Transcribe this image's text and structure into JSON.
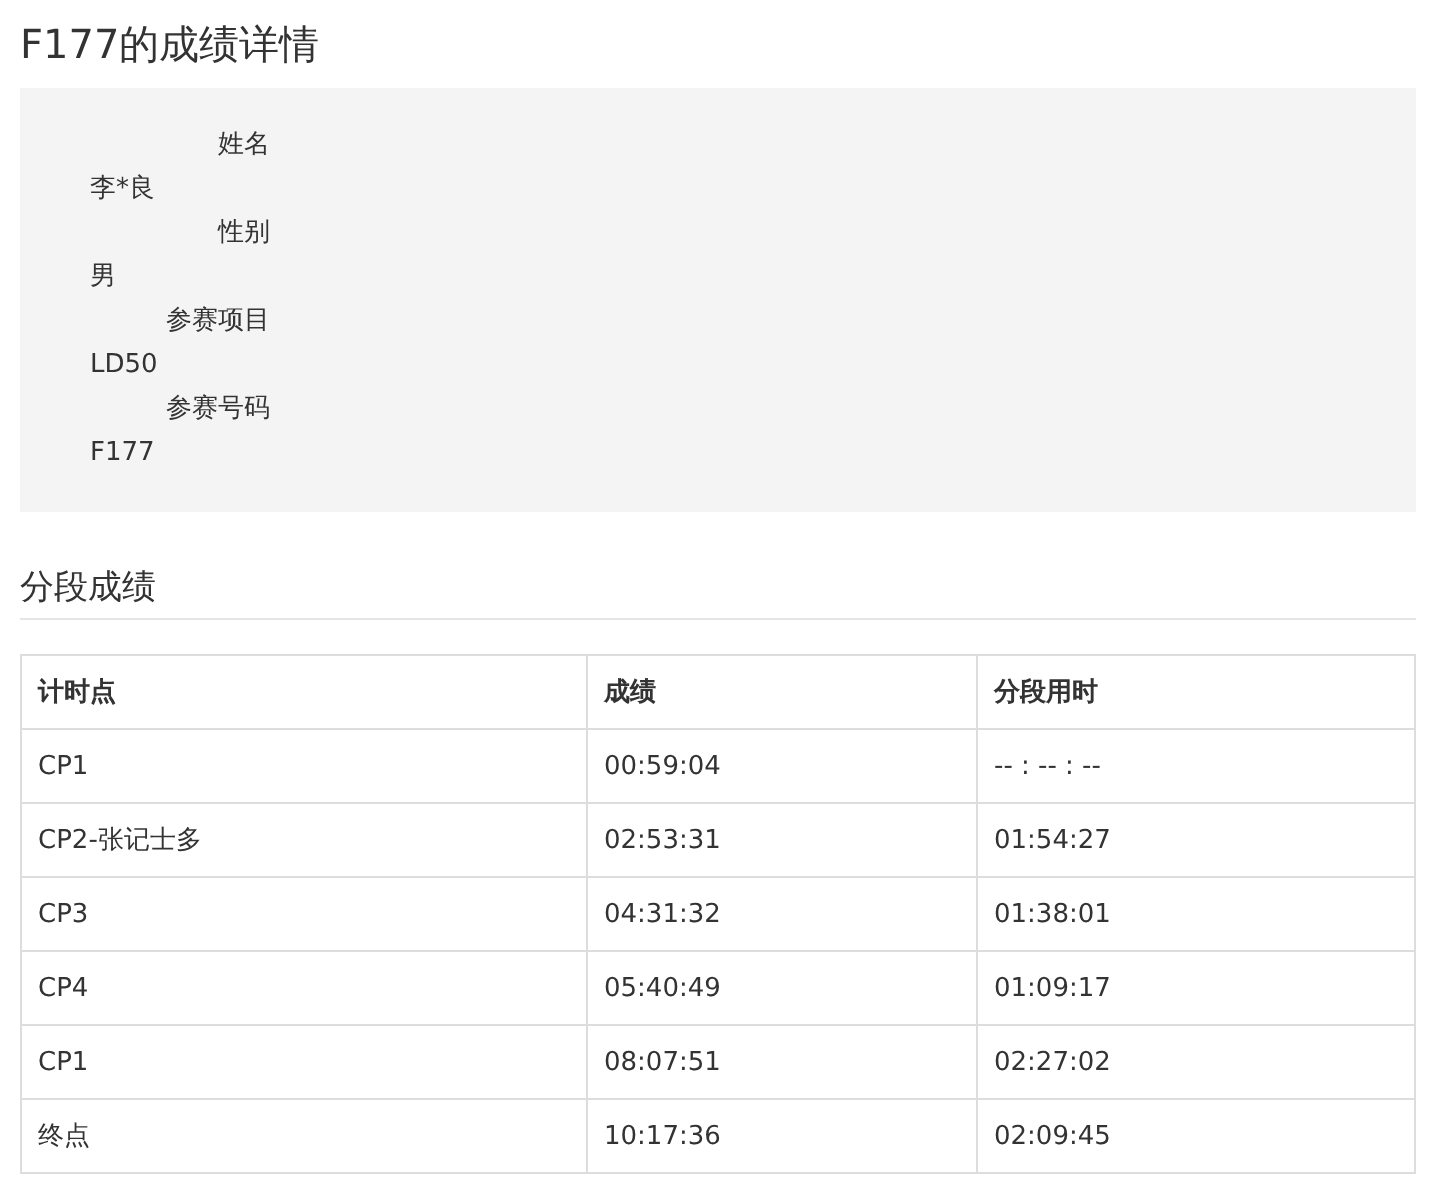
{
  "title": "F177的成绩详情",
  "details": [
    {
      "label": "姓名",
      "value": "李*良"
    },
    {
      "label": "性别",
      "value": "男"
    },
    {
      "label": "参赛项目",
      "value": "LD50"
    },
    {
      "label": "参赛号码",
      "value": "F177"
    }
  ],
  "section_title": "分段成绩",
  "table": {
    "columns": [
      "计时点",
      "成绩",
      "分段用时"
    ],
    "rows": [
      [
        "CP1",
        "00:59:04",
        "-- : -- : --"
      ],
      [
        "CP2-张记士多",
        "02:53:31",
        "01:54:27"
      ],
      [
        "CP3",
        "04:31:32",
        "01:38:01"
      ],
      [
        "CP4",
        "05:40:49",
        "01:09:17"
      ],
      [
        "CP1",
        "08:07:51",
        "02:27:02"
      ],
      [
        "终点",
        "10:17:36",
        "02:09:45"
      ]
    ]
  }
}
